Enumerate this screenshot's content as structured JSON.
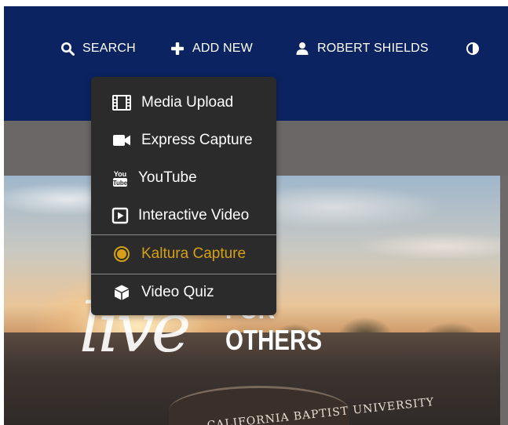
{
  "topnav": {
    "search_label": "SEARCH",
    "add_new_label": "ADD NEW",
    "user_name": "ROBERT SHIELDS"
  },
  "add_new_menu": {
    "items": [
      {
        "label": "Media Upload",
        "icon": "film-icon"
      },
      {
        "label": "Express Capture",
        "icon": "video-camera-icon"
      },
      {
        "label": "YouTube",
        "icon": "youtube-icon"
      },
      {
        "label": "Interactive Video",
        "icon": "play-square-icon"
      },
      {
        "label": "Kaltura Capture",
        "icon": "record-dot-icon",
        "highlighted": true
      },
      {
        "label": "Video Quiz",
        "icon": "cube-icon"
      }
    ]
  },
  "banner": {
    "script_text": "live",
    "for_text": "FOR",
    "others_text": "OTHERS",
    "arch_text": "CALIFORNIA BAPTIST UNIVERSITY"
  },
  "colors": {
    "nav_bg": "#0b2461",
    "menu_bg": "#2b2b2b",
    "highlight": "#d4a017"
  }
}
